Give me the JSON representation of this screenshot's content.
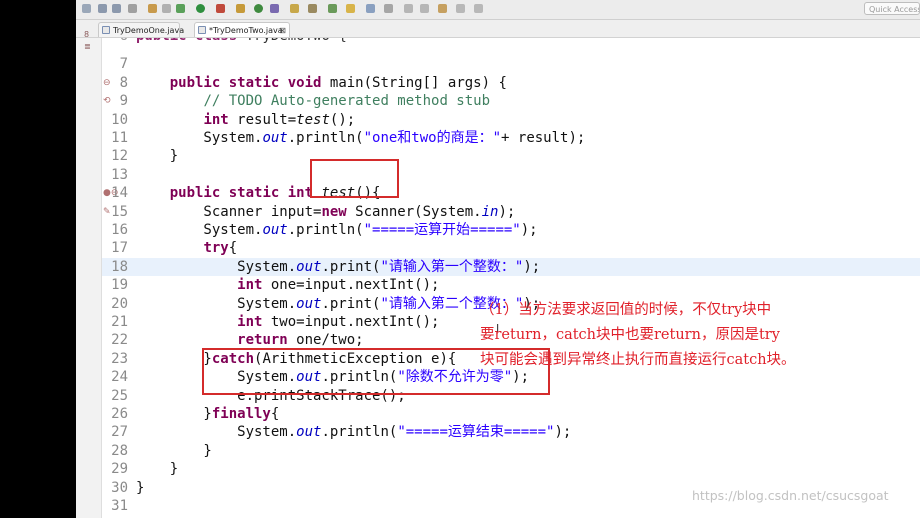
{
  "toolbar": {
    "quick_access_placeholder": "Quick Access"
  },
  "tabs": [
    {
      "label": "TryDemoOne.java",
      "active": false
    },
    {
      "label": "*TryDemoTwo.java",
      "active": true,
      "close": "⊠"
    }
  ],
  "side_glyphs": [
    "8",
    "≣"
  ],
  "editor": {
    "highlighted_line": "18",
    "lines": [
      {
        "n": "6",
        "code": "public class TryDemoTwo {",
        "cut": true
      },
      {
        "n": "7",
        "code": ""
      },
      {
        "n": "8",
        "code": "    public static void main(String[] args) {",
        "mark": "⊖"
      },
      {
        "n": "9",
        "code": "        // TODO Auto-generated method stub",
        "mark": "⟲"
      },
      {
        "n": "10",
        "code": "        int result=test();"
      },
      {
        "n": "11",
        "code": "        System.out.println(\"one和two的商是：\"+ result);"
      },
      {
        "n": "12",
        "code": "    }"
      },
      {
        "n": "13",
        "code": ""
      },
      {
        "n": "14",
        "code": "    public static int test(){",
        "mark": "●⊖"
      },
      {
        "n": "15",
        "code": "        Scanner input=new Scanner(System.in);",
        "mark": "✎"
      },
      {
        "n": "16",
        "code": "        System.out.println(\"=====运算开始=====\");"
      },
      {
        "n": "17",
        "code": "        try{"
      },
      {
        "n": "18",
        "code": "            System.out.print(\"请输入第一个整数：\");"
      },
      {
        "n": "19",
        "code": "            int one=input.nextInt();"
      },
      {
        "n": "20",
        "code": "            System.out.print(\"请输入第二个整数：\");"
      },
      {
        "n": "21",
        "code": "            int two=input.nextInt();"
      },
      {
        "n": "22",
        "code": "            return one/two;"
      },
      {
        "n": "23",
        "code": "        }catch(ArithmeticException e){"
      },
      {
        "n": "24",
        "code": "            System.out.println(\"除数不允许为零\");"
      },
      {
        "n": "25",
        "code": "            e.printStackTrace();"
      },
      {
        "n": "26",
        "code": "        }finally{"
      },
      {
        "n": "27",
        "code": "            System.out.println(\"=====运算结束=====\");"
      },
      {
        "n": "28",
        "code": "        }"
      },
      {
        "n": "29",
        "code": "    }"
      },
      {
        "n": "30",
        "code": "}"
      },
      {
        "n": "31",
        "code": ""
      }
    ]
  },
  "annotation": {
    "lines": [
      "（1）当方法要求返回值的时候，不仅try块中",
      "要return，catch块中也要return，原因是try",
      "块可能会遇到异常终止执行而直接运行catch块。"
    ],
    "color": "#e0202a"
  },
  "watermark": "https://blog.csdn.net/csucsgoat",
  "colors": {
    "keyword": "#7f0055",
    "comment": "#3f7f5f",
    "string": "#2a00ff",
    "field": "#0000c0",
    "highlight_line": "#e8f1fc",
    "box": "#d42b2b"
  }
}
